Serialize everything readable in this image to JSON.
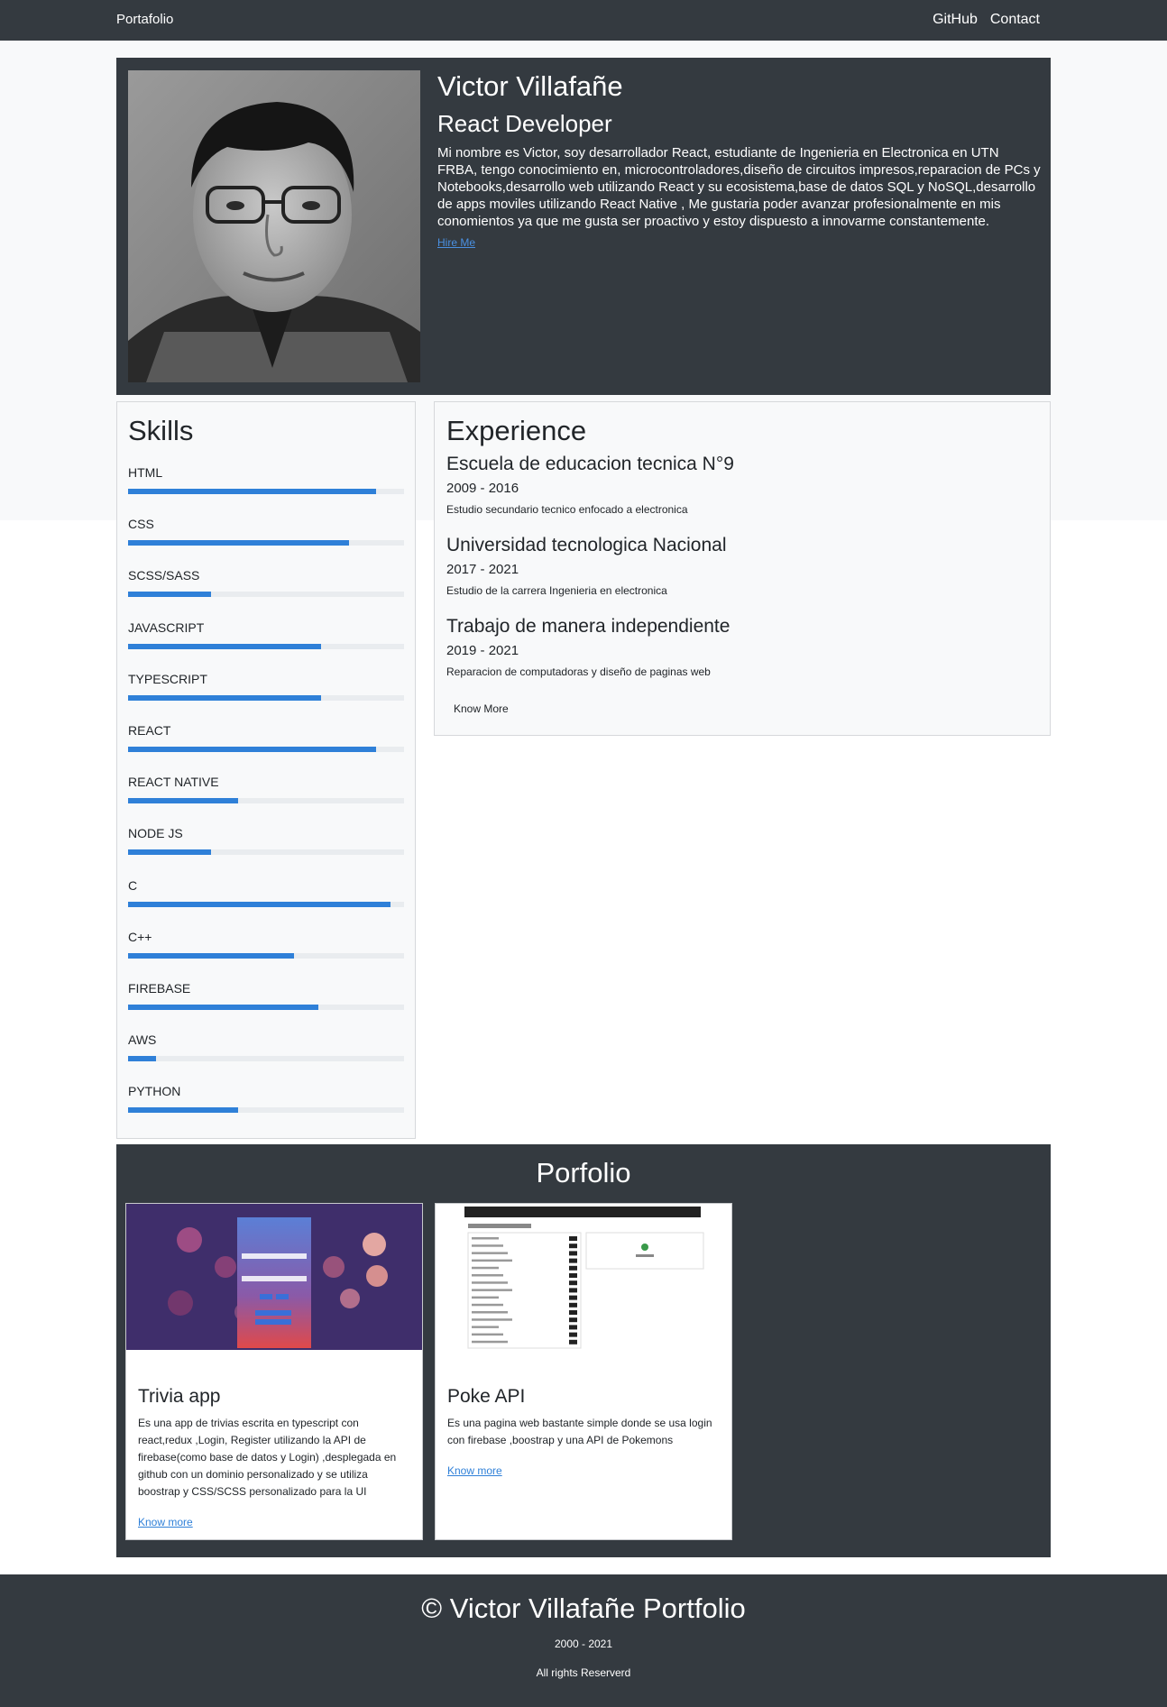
{
  "nav": {
    "brand": "Portafolio",
    "links": [
      {
        "label": "GitHub"
      },
      {
        "label": "Contact"
      }
    ]
  },
  "hero": {
    "name": "Victor Villafañe",
    "role": "React Developer",
    "description": "Mi nombre es Victor, soy desarrollador React, estudiante de Ingenieria en Electronica en UTN FRBA, tengo conocimiento en, microcontroladores,diseño de circuitos impresos,reparacion de PCs y Notebooks,desarrollo web utilizando React y su ecosistema,base de datos SQL y NoSQL,desarrollo de apps moviles utilizando React Native , Me gustaria poder avanzar profesionalmente en mis conomientos ya que me gusta ser proactivo y estoy dispuesto a innovarme constantemente.",
    "hire_label": "Hire Me"
  },
  "skills": {
    "title": "Skills",
    "items": [
      {
        "name": "HTML",
        "level": 0.9
      },
      {
        "name": "CSS",
        "level": 0.8
      },
      {
        "name": "SCSS/SASS",
        "level": 0.3
      },
      {
        "name": "JAVASCRIPT",
        "level": 0.7
      },
      {
        "name": "TYPESCRIPT",
        "level": 0.7
      },
      {
        "name": "REACT",
        "level": 0.9
      },
      {
        "name": "REACT NATIVE",
        "level": 0.4
      },
      {
        "name": "NODE JS",
        "level": 0.3
      },
      {
        "name": "C",
        "level": 0.95
      },
      {
        "name": "C++",
        "level": 0.6
      },
      {
        "name": "FIREBASE",
        "level": 0.69
      },
      {
        "name": "AWS",
        "level": 0.1
      },
      {
        "name": "PYTHON",
        "level": 0.4
      }
    ]
  },
  "experience": {
    "title": "Experience",
    "items": [
      {
        "title": "Escuela de educacion tecnica N°9",
        "years": "2009 - 2016",
        "description": "Estudio secundario tecnico enfocado a electronica"
      },
      {
        "title": "Universidad tecnologica Nacional",
        "years": "2017 - 2021",
        "description": "Estudio de la carrera Ingenieria en electronica"
      },
      {
        "title": "Trabajo de manera independiente",
        "years": "2019 - 2021",
        "description": "Reparacion de computadoras y diseño de paginas web"
      }
    ],
    "know_more_label": "Know More"
  },
  "portfolio": {
    "title": "Porfolio",
    "cards": [
      {
        "title": "Trivia app",
        "description": "Es una app de trivias escrita en typescript con react,redux ,Login, Register utilizando la API de firebase(como base de datos y Login) ,desplegada en github con un dominio personalizado y se utiliza boostrap y CSS/SCSS personalizado para la UI",
        "link_label": "Know more"
      },
      {
        "title": "Poke API",
        "description": "Es una pagina web bastante simple donde se usa login con firebase ,boostrap y una API de Pokemons",
        "link_label": "Know more"
      }
    ]
  },
  "footer": {
    "title": "© Victor Villafañe Portfolio",
    "years": "2000 - 2021",
    "rights": "All rights Reserverd"
  },
  "colors": {
    "dark": "#343a40",
    "light": "#f8f9fa",
    "accent": "#2f80d8"
  }
}
